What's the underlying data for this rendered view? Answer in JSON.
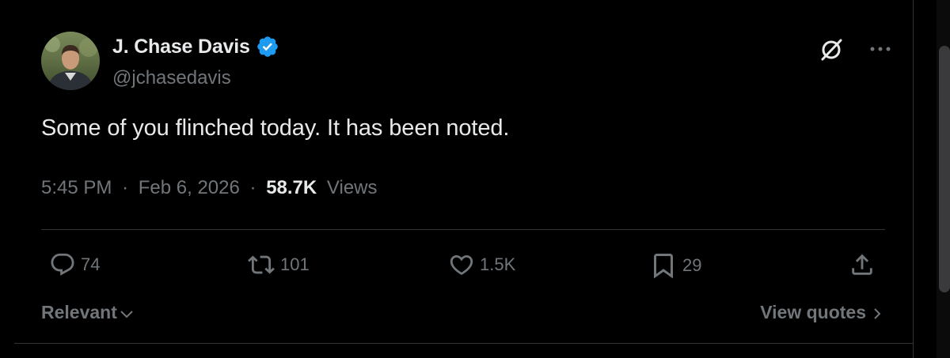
{
  "author": {
    "name": "J. Chase Davis",
    "handle": "@jchasedavis",
    "verified": true
  },
  "tweet": {
    "text": "Some of you flinched today. It has been noted."
  },
  "meta": {
    "time": "5:45 PM",
    "sep1": "·",
    "date": "Feb 6, 2026",
    "sep2": "·",
    "views_count": "58.7K",
    "views_label": "Views"
  },
  "actions": {
    "replies": "74",
    "reposts": "101",
    "likes": "1.5K",
    "bookmarks": "29"
  },
  "footer": {
    "sort_label": "Relevant",
    "view_quotes_label": "View quotes"
  },
  "colors": {
    "background": "#000000",
    "text_primary": "#e7e9ea",
    "text_secondary": "#71767b",
    "border": "#2f3336",
    "verified_badge": "#1d9bf0"
  }
}
